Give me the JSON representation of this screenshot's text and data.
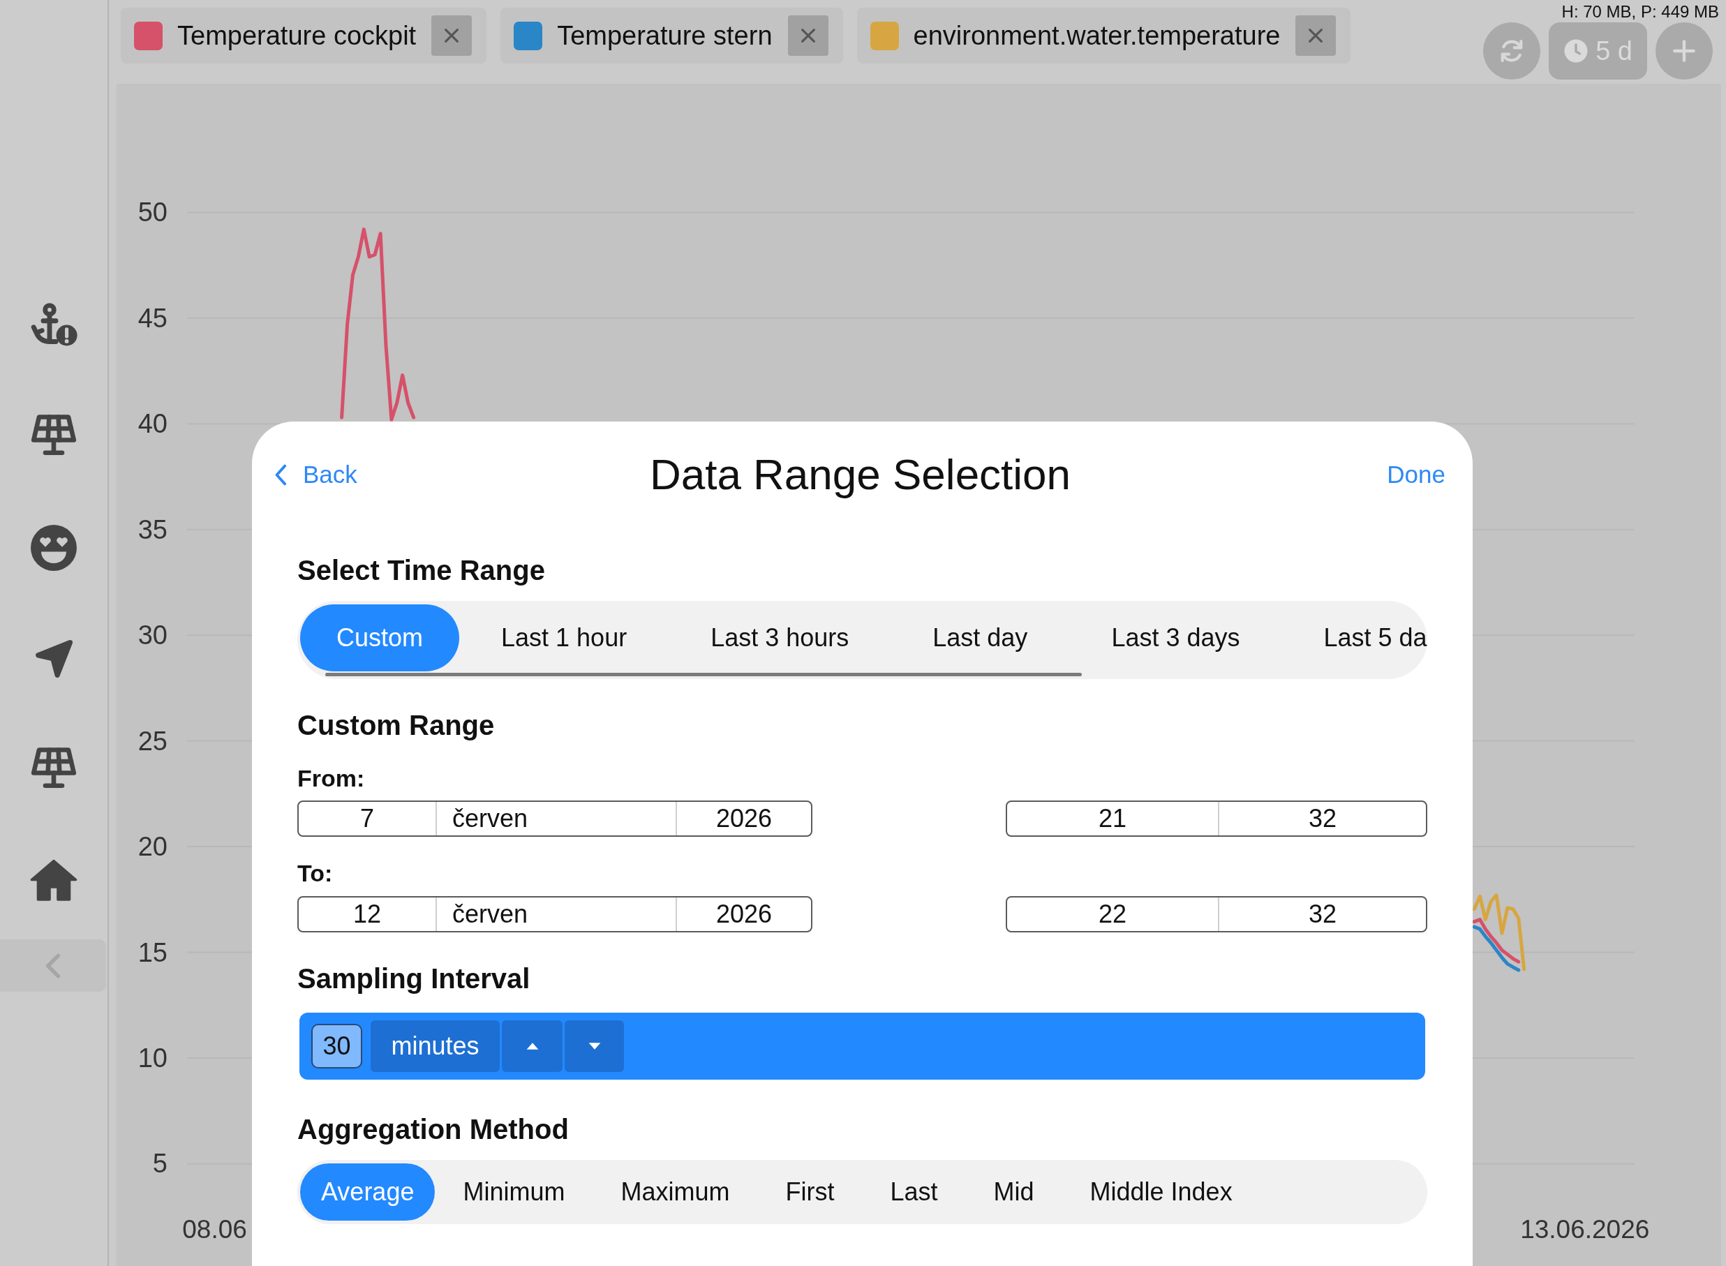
{
  "tabs": [
    {
      "label": "Temperature cockpit",
      "color": "#d6516a"
    },
    {
      "label": "Temperature stern",
      "color": "#2b86c7"
    },
    {
      "label": "environment.water.temperature",
      "color": "#d7a642"
    }
  ],
  "memory_usage": "H: 70 MB, P: 449 MB",
  "time_span_button": {
    "label": "5 d"
  },
  "chart": {
    "chart_data": {
      "type": "line",
      "grid": true,
      "categories": [
        null,
        null,
        null,
        null,
        null,
        "08.06",
        null,
        null,
        null,
        null,
        null,
        null,
        null,
        null,
        null,
        null,
        null,
        null,
        null,
        null,
        null,
        null,
        null,
        null,
        null,
        null,
        null,
        null,
        null,
        null,
        null,
        null,
        null,
        null,
        null,
        null,
        null,
        null,
        null,
        null,
        null,
        null,
        null,
        null,
        null,
        null,
        null,
        null,
        null,
        null,
        null,
        null,
        null,
        null,
        null,
        null,
        null,
        null,
        null,
        null,
        null,
        null,
        null,
        null,
        null,
        null,
        null,
        null,
        null,
        null,
        null,
        null,
        null,
        null,
        null,
        null,
        null,
        null,
        null,
        null,
        null,
        null,
        null,
        null,
        null,
        null,
        null,
        null,
        null,
        null,
        null,
        null,
        null,
        null,
        null,
        null,
        null,
        null,
        null,
        null,
        null,
        null,
        null,
        null,
        null,
        null,
        null,
        null,
        null,
        null,
        null,
        null,
        null,
        null,
        null,
        null,
        null,
        null,
        null,
        null,
        null,
        null,
        null,
        null,
        null,
        null,
        null,
        null,
        null,
        null,
        null,
        null,
        null,
        null,
        null,
        null,
        null,
        null,
        null,
        null,
        null,
        null,
        null,
        null,
        null,
        null,
        null,
        null,
        null,
        null,
        null,
        null,
        null,
        null,
        null,
        null,
        null,
        null,
        null,
        null,
        null,
        null,
        null,
        null,
        null,
        null,
        null,
        null,
        null,
        null,
        null,
        null,
        null,
        null,
        null,
        null,
        null,
        null,
        null,
        null,
        null,
        null,
        null,
        null,
        null,
        null,
        null,
        null,
        null,
        null,
        null,
        null,
        null,
        null,
        null,
        null,
        null,
        null,
        null,
        null,
        null,
        null,
        null,
        null,
        null,
        null,
        null,
        null,
        null,
        null,
        null,
        null,
        null,
        null,
        null,
        null,
        null,
        null,
        null,
        null,
        null,
        null,
        null,
        null,
        null,
        null,
        null,
        null,
        null,
        null,
        null,
        null,
        null,
        null,
        null,
        null,
        null,
        null,
        null,
        null,
        null,
        null,
        null,
        null,
        null,
        null,
        null,
        null,
        null,
        null,
        null,
        null,
        null,
        "13.06.2026",
        null,
        null,
        null,
        null,
        null,
        null,
        null,
        null,
        null
      ],
      "ylim": [
        5,
        50
      ],
      "yticks": [
        5,
        10,
        15,
        20,
        25,
        30,
        35,
        40,
        45,
        50
      ],
      "series": [
        {
          "color": "#d6516a",
          "values": [
            null,
            null,
            null,
            null,
            null,
            null,
            null,
            null,
            null,
            null,
            null,
            null,
            null,
            null,
            null,
            null,
            null,
            null,
            null,
            null,
            null,
            null,
            null,
            null,
            null,
            null,
            null,
            null,
            40.3,
            44.7,
            47.05,
            47.9,
            49.2,
            47.9,
            48.0,
            49.0,
            43.7,
            40.2,
            41.0,
            42.3,
            41.0,
            40.3,
            null,
            null,
            null,
            null,
            null,
            null,
            null,
            null,
            null,
            null,
            null,
            null,
            null,
            null,
            null,
            null,
            null,
            null,
            null,
            null,
            null,
            null,
            null,
            null,
            null,
            null,
            null,
            null,
            null,
            null,
            null,
            null,
            null,
            null,
            null,
            null,
            null,
            null,
            null,
            null,
            null,
            null,
            null,
            null,
            null,
            null,
            null,
            null,
            null,
            null,
            null,
            null,
            null,
            null,
            null,
            null,
            null,
            null,
            null,
            null,
            null,
            null,
            null,
            null,
            null,
            null,
            null,
            null,
            null,
            null,
            null,
            null,
            null,
            null,
            null,
            null,
            null,
            null,
            null,
            null,
            null,
            null,
            null,
            null,
            null,
            null,
            null,
            null,
            null,
            null,
            null,
            null,
            null,
            null,
            null,
            null,
            null,
            null,
            null,
            null,
            null,
            null,
            null,
            null,
            null,
            null,
            null,
            null,
            null,
            null,
            null,
            null,
            null,
            null,
            null,
            null,
            null,
            null,
            null,
            null,
            null,
            null,
            null,
            null,
            null,
            null,
            null,
            null,
            null,
            null,
            null,
            null,
            null,
            null,
            null,
            null,
            null,
            null,
            null,
            null,
            null,
            null,
            null,
            null,
            null,
            null,
            null,
            null,
            null,
            null,
            null,
            null,
            null,
            null,
            null,
            null,
            null,
            null,
            null,
            null,
            null,
            null,
            null,
            null,
            null,
            null,
            null,
            null,
            null,
            null,
            null,
            null,
            null,
            null,
            null,
            null,
            null,
            null,
            null,
            null,
            null,
            null,
            null,
            null,
            null,
            null,
            null,
            null,
            null,
            null,
            null,
            16.45,
            16.55,
            16.1,
            15.75,
            15.45,
            15.1,
            14.9,
            14.7,
            14.55,
            null,
            null,
            null,
            null,
            null,
            null,
            null,
            null,
            null,
            null,
            null,
            null,
            null,
            null,
            null,
            null,
            null,
            null,
            null,
            null,
            null
          ]
        },
        {
          "color": "#2b86c7",
          "values": [
            null,
            null,
            null,
            null,
            null,
            null,
            null,
            null,
            null,
            null,
            null,
            null,
            null,
            null,
            null,
            null,
            null,
            null,
            null,
            null,
            null,
            null,
            null,
            null,
            null,
            null,
            null,
            null,
            null,
            null,
            null,
            null,
            null,
            null,
            null,
            null,
            null,
            null,
            null,
            null,
            null,
            null,
            null,
            null,
            null,
            null,
            null,
            null,
            null,
            null,
            null,
            null,
            null,
            null,
            null,
            null,
            null,
            null,
            null,
            null,
            null,
            null,
            null,
            null,
            null,
            null,
            null,
            null,
            null,
            null,
            null,
            null,
            null,
            null,
            null,
            null,
            null,
            null,
            null,
            null,
            null,
            null,
            null,
            null,
            null,
            null,
            null,
            null,
            null,
            null,
            null,
            null,
            null,
            null,
            null,
            null,
            null,
            null,
            null,
            null,
            null,
            null,
            null,
            null,
            null,
            null,
            null,
            null,
            null,
            null,
            null,
            null,
            null,
            null,
            null,
            null,
            null,
            null,
            null,
            null,
            null,
            null,
            null,
            null,
            null,
            null,
            null,
            null,
            null,
            null,
            null,
            null,
            null,
            null,
            null,
            null,
            null,
            null,
            null,
            null,
            null,
            null,
            null,
            null,
            null,
            null,
            null,
            null,
            null,
            null,
            null,
            null,
            null,
            null,
            null,
            null,
            null,
            null,
            null,
            null,
            null,
            null,
            null,
            null,
            null,
            null,
            null,
            null,
            null,
            null,
            null,
            null,
            null,
            null,
            null,
            null,
            null,
            null,
            null,
            null,
            null,
            null,
            null,
            null,
            null,
            null,
            null,
            null,
            null,
            null,
            null,
            null,
            null,
            null,
            null,
            null,
            null,
            null,
            null,
            null,
            null,
            null,
            null,
            null,
            null,
            null,
            null,
            null,
            null,
            null,
            null,
            null,
            null,
            null,
            null,
            null,
            null,
            null,
            null,
            null,
            null,
            null,
            null,
            null,
            null,
            null,
            null,
            null,
            null,
            null,
            null,
            null,
            null,
            16.2,
            16.1,
            15.75,
            15.45,
            15.1,
            14.75,
            14.45,
            14.3,
            14.16,
            null,
            null,
            null,
            null,
            null,
            null,
            null,
            null,
            null,
            null,
            null,
            null,
            null,
            null,
            null,
            null,
            null,
            null,
            null,
            null,
            null
          ]
        },
        {
          "color": "#d7a642",
          "values": [
            null,
            null,
            null,
            null,
            null,
            null,
            null,
            null,
            null,
            null,
            null,
            null,
            null,
            null,
            null,
            null,
            null,
            null,
            null,
            null,
            null,
            null,
            null,
            null,
            null,
            null,
            null,
            null,
            null,
            null,
            null,
            null,
            null,
            null,
            null,
            null,
            null,
            null,
            null,
            null,
            null,
            null,
            null,
            null,
            null,
            null,
            null,
            null,
            null,
            null,
            null,
            null,
            null,
            null,
            null,
            null,
            null,
            null,
            null,
            null,
            null,
            null,
            null,
            null,
            null,
            null,
            null,
            null,
            null,
            null,
            null,
            null,
            null,
            null,
            null,
            null,
            null,
            null,
            null,
            null,
            null,
            null,
            null,
            null,
            null,
            null,
            null,
            null,
            null,
            null,
            null,
            null,
            null,
            null,
            null,
            null,
            null,
            null,
            null,
            null,
            null,
            null,
            null,
            null,
            null,
            null,
            null,
            null,
            null,
            null,
            null,
            null,
            null,
            null,
            null,
            null,
            null,
            null,
            null,
            null,
            null,
            null,
            null,
            null,
            null,
            null,
            null,
            null,
            null,
            null,
            null,
            null,
            null,
            null,
            null,
            null,
            null,
            null,
            null,
            null,
            null,
            null,
            null,
            null,
            null,
            null,
            null,
            null,
            null,
            null,
            null,
            null,
            null,
            null,
            null,
            null,
            null,
            null,
            null,
            null,
            null,
            null,
            null,
            null,
            null,
            null,
            null,
            null,
            null,
            null,
            null,
            null,
            null,
            null,
            null,
            null,
            null,
            null,
            null,
            null,
            null,
            null,
            null,
            null,
            null,
            null,
            null,
            null,
            null,
            null,
            null,
            null,
            null,
            null,
            null,
            null,
            null,
            null,
            null,
            null,
            null,
            null,
            null,
            null,
            null,
            null,
            null,
            null,
            null,
            null,
            null,
            null,
            null,
            null,
            null,
            null,
            null,
            null,
            null,
            null,
            null,
            null,
            null,
            null,
            null,
            null,
            null,
            null,
            null,
            null,
            null,
            null,
            null,
            17.05,
            17.65,
            16.55,
            17.4,
            17.7,
            15.9,
            17.1,
            17.05,
            16.6,
            14.2,
            null,
            null,
            null,
            null,
            null,
            null,
            null,
            null,
            null,
            null,
            null,
            null,
            null,
            null,
            null,
            null,
            null,
            null,
            null,
            null
          ]
        }
      ]
    }
  },
  "dialog": {
    "back": "Back",
    "title": "Data Range Selection",
    "done": "Done",
    "time_range": {
      "heading": "Select Time Range",
      "options": [
        {
          "label": "Custom",
          "selected": true
        },
        {
          "label": "Last 1 hour",
          "selected": false
        },
        {
          "label": "Last 3 hours",
          "selected": false
        },
        {
          "label": "Last day",
          "selected": false
        },
        {
          "label": "Last 3 days",
          "selected": false
        },
        {
          "label": "Last 5 da",
          "selected": false
        }
      ]
    },
    "custom_range": {
      "heading": "Custom Range",
      "from": {
        "label": "From:",
        "day": "7",
        "month": "červen",
        "year": "2026",
        "hour": "21",
        "minute": "32"
      },
      "to": {
        "label": "To:",
        "day": "12",
        "month": "červen",
        "year": "2026",
        "hour": "22",
        "minute": "32"
      }
    },
    "sampling_interval": {
      "heading": "Sampling Interval",
      "value": "30",
      "unit": "minutes"
    },
    "aggregation": {
      "heading": "Aggregation Method",
      "options": [
        {
          "label": "Average",
          "selected": true
        },
        {
          "label": "Minimum",
          "selected": false
        },
        {
          "label": "Maximum",
          "selected": false
        },
        {
          "label": "First",
          "selected": false
        },
        {
          "label": "Last",
          "selected": false
        },
        {
          "label": "Mid",
          "selected": false
        },
        {
          "label": "Middle Index",
          "selected": false
        }
      ]
    }
  }
}
